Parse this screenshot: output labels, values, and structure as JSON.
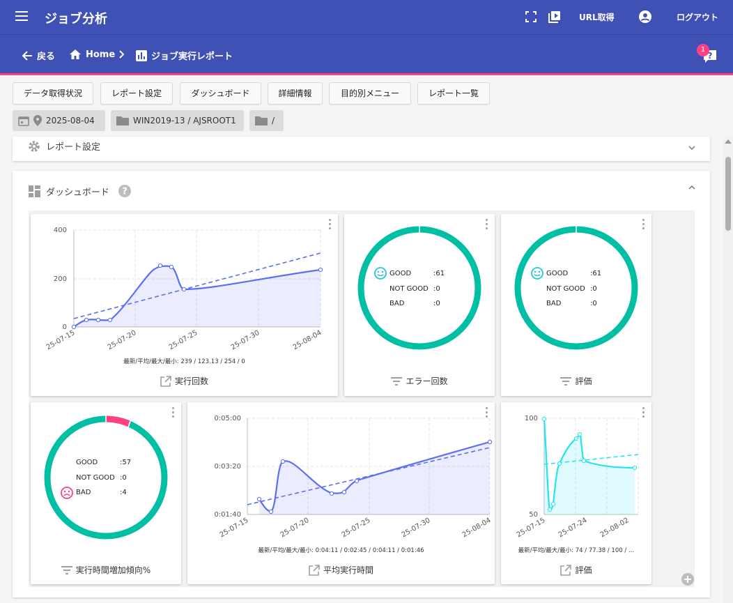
{
  "app": {
    "title": "ジョブ分析",
    "url_label": "URL取得",
    "logout_label": "ログアウト"
  },
  "breadcrumb": {
    "back": "戻る",
    "home": "Home",
    "current": "ジョブ実行レポート",
    "help_badge": "1"
  },
  "toolbar": [
    "データ取得状況",
    "レポート設定",
    "ダッシュボード",
    "詳細情報",
    "目的別メニュー",
    "レポート一覧"
  ],
  "filters": {
    "date": "2025-08-04",
    "folder": "WIN2019-13 / AJSROOT1",
    "path": "/"
  },
  "sections": {
    "report_settings": "レポート設定",
    "dashboard": "ダッシュボード"
  },
  "cards": {
    "exec_count": {
      "title": "実行回数",
      "stats": "最新/平均/最大/最小: 239 / 123.13 / 254 / 0",
      "y_ticks": [
        "400",
        "200",
        "0"
      ],
      "x_ticks": [
        "25-07-15",
        "25-07-20",
        "25-07-25",
        "25-07-30",
        "25-08-04"
      ]
    },
    "error_count": {
      "title": "エラー回数",
      "rows": [
        {
          "label": "GOOD",
          "value": ":61"
        },
        {
          "label": "NOT GOOD",
          "value": ":0"
        },
        {
          "label": "BAD",
          "value": ":0"
        }
      ]
    },
    "evaluation_donut": {
      "title": "評価",
      "rows": [
        {
          "label": "GOOD",
          "value": ":61"
        },
        {
          "label": "NOT GOOD",
          "value": ":0"
        },
        {
          "label": "BAD",
          "value": ":0"
        }
      ]
    },
    "exec_time_trend": {
      "title": "実行時間増加傾向%",
      "rows": [
        {
          "label": "GOOD",
          "value": ":57"
        },
        {
          "label": "NOT GOOD",
          "value": ":0"
        },
        {
          "label": "BAD",
          "value": ":4"
        }
      ]
    },
    "avg_exec_time": {
      "title": "平均実行時間",
      "stats": "最新/平均/最大/最小: 0:04:11 / 0:02:45 / 0:04:11 / 0:01:46",
      "y_ticks": [
        "0:05:00",
        "0:03:20",
        "0:01:40"
      ],
      "x_ticks": [
        "25-07-15",
        "25-07-20",
        "25-07-25",
        "25-07-30",
        "25-08-04"
      ]
    },
    "evaluation_line": {
      "title": "評価",
      "stats": "最新/平均/最大/最小: 74 / 77.38 / 100 / …",
      "y_ticks": [
        "100",
        "50"
      ],
      "x_ticks": [
        "25-07-15",
        "25-07-24",
        "25-08-02"
      ]
    }
  },
  "colors": {
    "appbar": "#3f51b5",
    "accent": "#ff4081",
    "good": "#00bfa5",
    "bad": "#ff4081",
    "line": "#5b6ef5",
    "cyan": "#22e5f0"
  },
  "chart_data": [
    {
      "type": "line",
      "title": "",
      "x": [
        "25-07-15",
        "25-07-17",
        "25-07-19",
        "25-07-21",
        "25-07-23",
        "25-07-25",
        "25-08-04"
      ],
      "series": [
        {
          "values": [
            0,
            28,
            28,
            254,
            250,
            157,
            239
          ]
        }
      ],
      "ylim": [
        0,
        400
      ]
    },
    {
      "type": "line",
      "title": "",
      "x": [
        "25-07-15",
        "25-07-17",
        "25-07-19",
        "25-07-23",
        "25-07-25",
        "25-08-04"
      ],
      "series": [
        {
          "values": [
            "0:01:46",
            "0:03:23",
            "0:03:10",
            "0:02:05",
            "0:02:15",
            "0:04:11"
          ]
        }
      ],
      "ylim": [
        "0:01:40",
        "0:05:00"
      ]
    },
    {
      "type": "line",
      "title": "",
      "x": [
        "25-07-15",
        "25-07-16",
        "25-07-18",
        "25-07-22",
        "25-07-25",
        "25-08-04"
      ],
      "series": [
        {
          "values": [
            100,
            55,
            78,
            90,
            77,
            74
          ]
        }
      ],
      "ylim": [
        50,
        100
      ]
    }
  ]
}
